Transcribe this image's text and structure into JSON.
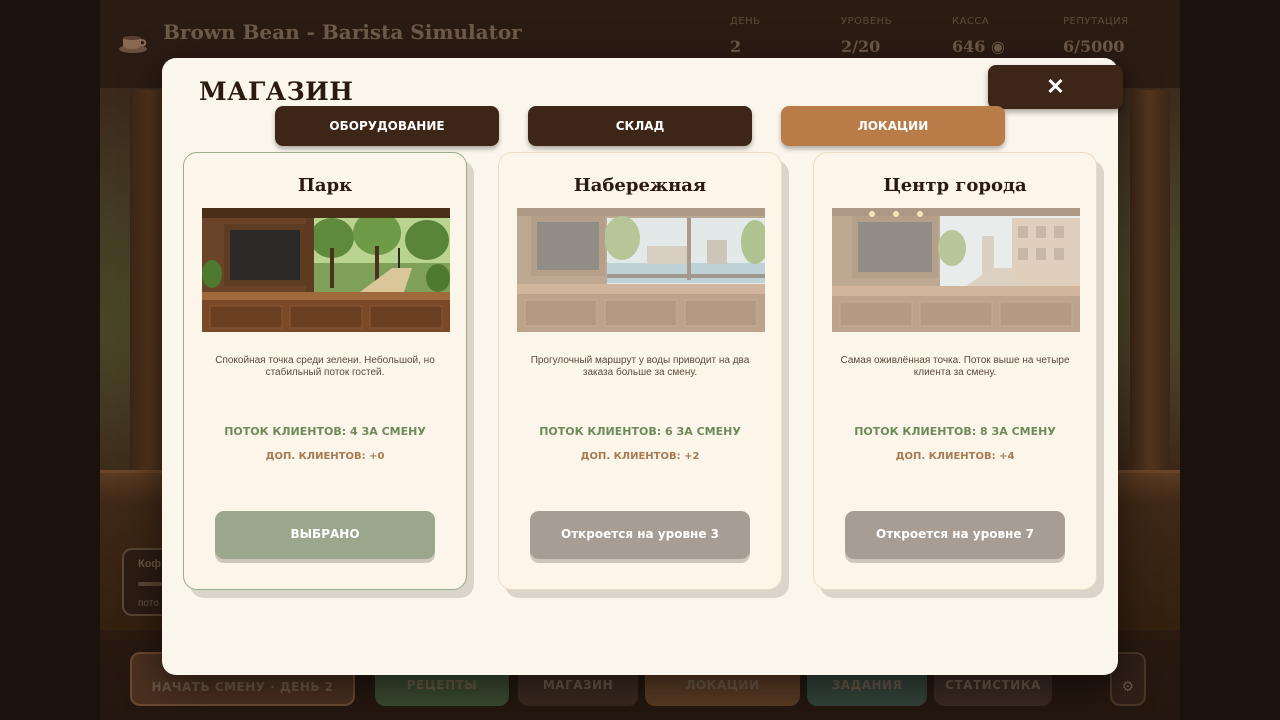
{
  "header": {
    "title": "Brown Bean - Barista Simulator",
    "stats": [
      {
        "label": "ДЕНЬ",
        "value": "2"
      },
      {
        "label": "УРОВЕНЬ",
        "value": "2/20"
      },
      {
        "label": "КАССА",
        "value": "646 ◉"
      },
      {
        "label": "РЕПУТАЦИЯ",
        "value": "6/5000"
      }
    ]
  },
  "side_panel": {
    "title": "Коф",
    "subtitle": "пото"
  },
  "bottom_nav": [
    "НАЧАТЬ СМЕНУ · ДЕНЬ 2",
    "РЕЦЕПТЫ",
    "МАГАЗИН",
    "ЛОКАЦИИ",
    "ЗАДАНИЯ",
    "СТАТИСТИКА"
  ],
  "modal": {
    "title": "МАГАЗИН",
    "close_label": "✕",
    "tabs": [
      {
        "label": "ОБОРУДОВАНИЕ",
        "active": false
      },
      {
        "label": "СКЛАД",
        "active": false
      },
      {
        "label": "ЛОКАЦИИ",
        "active": true
      }
    ],
    "locations": [
      {
        "name": "Парк",
        "description": "Спокойная точка среди зелени. Небольшой, но стабильный поток гостей.",
        "flow": "ПОТОК КЛИЕНТОВ: 4 ЗА СМЕНУ",
        "extra": "ДОП. КЛИЕНТОВ: +0",
        "button": "ВЫБРАНО",
        "state": "selected"
      },
      {
        "name": "Набережная",
        "description": "Прогулочный маршрут у воды приводит на два заказа больше за смену.",
        "flow": "ПОТОК КЛИЕНТОВ: 6 ЗА СМЕНУ",
        "extra": "ДОП. КЛИЕНТОВ: +2",
        "button": "Откроется на уровне 3",
        "state": "locked"
      },
      {
        "name": "Центр города",
        "description": "Самая оживлённая точка. Поток выше на четыре клиента за смену.",
        "flow": "ПОТОК КЛИЕНТОВ: 8 ЗА СМЕНУ",
        "extra": "ДОП. КЛИЕНТОВ: +4",
        "button": "Откроется на уровне 7",
        "state": "locked"
      }
    ]
  },
  "colors": {
    "modal_bg": "#fbf6ec",
    "tab_dark": "#3d2618",
    "tab_active": "#b97b48",
    "flow_green": "#6f8a5a",
    "extra_brown": "#a87a52",
    "selected_button": "#9aa78c",
    "locked_button": "#a89d95"
  }
}
